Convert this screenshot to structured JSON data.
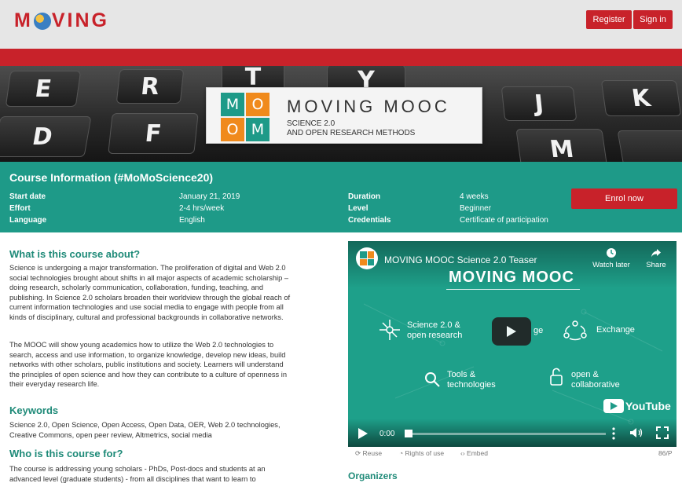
{
  "header": {
    "logo_text": "MOVING",
    "register_label": "Register",
    "signin_label": "Sign in",
    "brand_color": "#c8222a"
  },
  "banner": {
    "keys": [
      "E",
      "R",
      "T",
      "Y",
      "J",
      "K",
      "D",
      "F",
      "M"
    ],
    "tiles": [
      "M",
      "O",
      "O",
      "M"
    ],
    "title": "MOVING MOOC",
    "subtitle_line1": "SCIENCE 2.0",
    "subtitle_line2": "AND OPEN RESEARCH METHODS"
  },
  "course_info": {
    "title": "Course Information (#MoMoScience20)",
    "start_date_label": "Start date",
    "start_date": "January 21, 2019",
    "effort_label": "Effort",
    "effort": "2-4 hrs/week",
    "language_label": "Language",
    "language": "English",
    "duration_label": "Duration",
    "duration": "4 weeks",
    "level_label": "Level",
    "level": "Beginner",
    "credentials_label": "Credentials",
    "credentials": "Certificate of participation",
    "enrol_label": "Enrol now",
    "accent_color": "#1e9a88"
  },
  "about": {
    "heading": "What is this course about?",
    "p1": [
      "Science is undergoing a major transformation. The proliferation of digital and Web 2.0",
      "social technologies brought about shifts in all major aspects of academic scholarship –",
      "doing research, scholarly communication, collaboration, funding, teaching, and",
      "publishing. In Science 2.0 scholars broaden their worldview through the global reach of",
      "current information technologies and use social media to engage with people from all",
      "kinds of disciplinary, cultural and professional backgrounds in collaborative networks."
    ],
    "p2": [
      "The MOOC will show young academics how to utilize the Web 2.0 technologies to",
      "search, access and use information, to organize knowledge, develop new ideas, build",
      "networks with other scholars, public institutions and society. Learners will understand",
      "the principles of open science and how they can contribute to a culture of openness in",
      "their everyday research life."
    ]
  },
  "keywords": {
    "heading": "Keywords",
    "lines": [
      "Science 2.0, Open Science, Open Access, Open Data, OER, Web 2.0 technologies,",
      "Creative Commons, open peer review, Altmetrics, social media"
    ]
  },
  "audience": {
    "heading": "Who is this course for?",
    "lines": [
      "The course is addressing young scholars - PhDs, Post-docs and students at an",
      "advanced level (graduate students) - from all disciplines that want to learn to"
    ]
  },
  "video": {
    "title": "MOVING MOOC Science 2.0 Teaser",
    "watch_later": "Watch later",
    "share": "Share",
    "big_title": "MOVING MOOC",
    "item1_line1": "Science 2.0 &",
    "item1_line2": "open research",
    "item2": "ge",
    "item3": "Exchange",
    "item4_line1": "Tools &",
    "item4_line2": "technologies",
    "item5_line1": "open &",
    "item5_line2": "collaborative",
    "youtube": "YouTube",
    "time": "0:00",
    "reuse": "Reuse",
    "rights": "Rights of use",
    "embed": "Embed",
    "license": "86/P",
    "icons": [
      "play-icon",
      "more-icon",
      "volume-icon",
      "fullscreen-icon",
      "clock-icon",
      "share-icon"
    ]
  },
  "organizers": {
    "heading": "Organizers"
  }
}
